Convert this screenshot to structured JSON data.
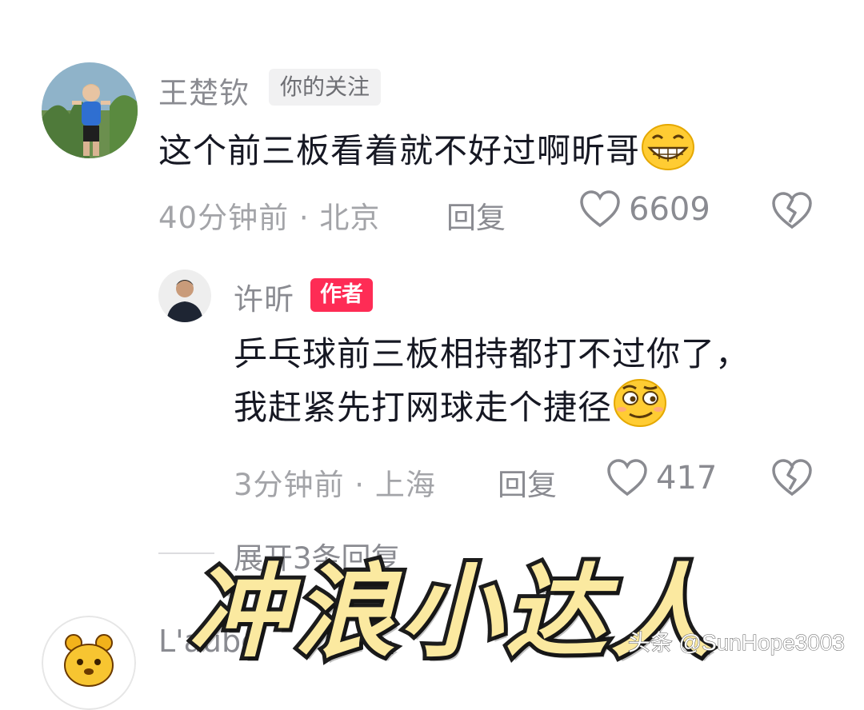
{
  "comments": [
    {
      "username": "王楚钦",
      "tag": "你的关注",
      "text": "这个前三板看着就不好过啊昕哥",
      "time_location": "40分钟前 · 北京",
      "reply_label": "回复",
      "likes": "6609",
      "emoji": "grin-emoji"
    }
  ],
  "reply": {
    "username": "许昕",
    "tag": "作者",
    "line1": "乒乓球前三板相持都打不过你了，",
    "line2": "我赶紧先打网球走个捷径",
    "time_location": "3分钟前 · 上海",
    "reply_label": "回复",
    "likes": "417",
    "emoji": "smirk-emoji"
  },
  "expand_replies": "展开3条回复",
  "next_comment": {
    "username": "L'aube"
  },
  "overlay_caption": "冲浪小达人",
  "watermark": "头条 @SunHope3003",
  "colors": {
    "author_tag": "#fe2c55",
    "text_primary": "#161823",
    "text_muted": "#8a8b91"
  }
}
